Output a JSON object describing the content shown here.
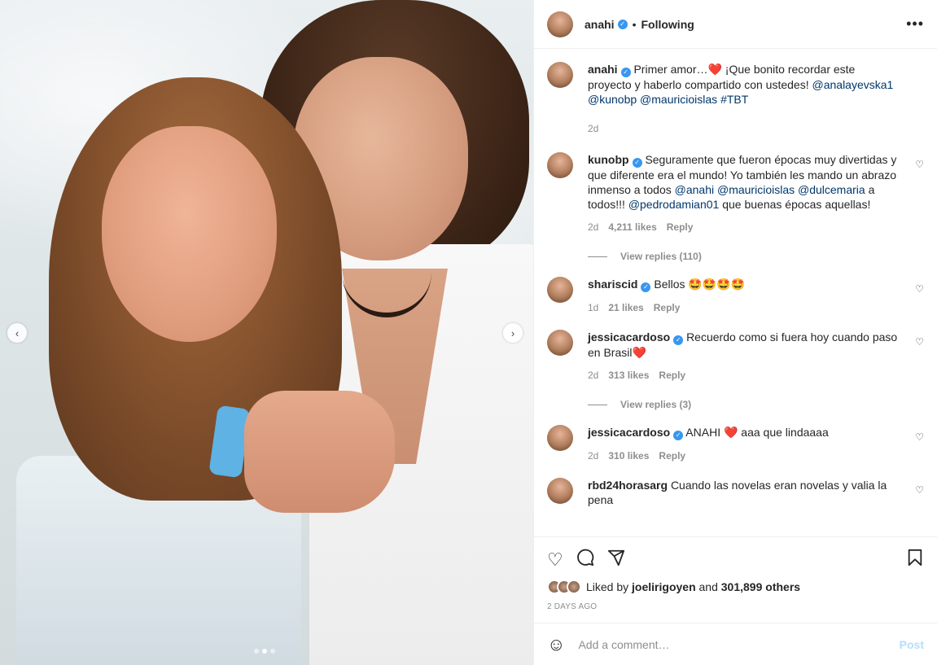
{
  "header": {
    "username": "anahi",
    "following_label": "Following",
    "more_icon": "more-icon"
  },
  "media": {
    "carousel_prev": "‹",
    "carousel_next": "›",
    "carousel_count": 3,
    "carousel_active_index": 1
  },
  "caption": {
    "username": "anahi",
    "text_start": "Primer amor…",
    "text_mid": " ¡Que bonito recordar este proyecto y haberlo compartido con ustedes! ",
    "mentions": [
      "@analayevska1",
      "@kunobp",
      "@mauricioislas"
    ],
    "hashtag": "#TBT",
    "time": "2d"
  },
  "comments": [
    {
      "username": "kunobp",
      "text_a": "Seguramente que fueron épocas muy divertidas y que diferente era el mundo! Yo también les mando un abrazo inmenso a todos ",
      "mention1": "@anahi",
      "mention2": "@mauricioislas",
      "mention3": "@dulcemaria",
      "text_b": " a todos!!! ",
      "mention4": "@pedrodamian01",
      "text_c": " que buenas épocas aquellas!",
      "time": "2d",
      "likes": "4,211 likes",
      "reply": "Reply",
      "view_replies": "View replies (110)"
    },
    {
      "username": "shariscid",
      "text": "Bellos 🤩🤩🤩🤩",
      "time": "1d",
      "likes": "21 likes",
      "reply": "Reply"
    },
    {
      "username": "jessicacardoso",
      "text": "Recuerdo como si fuera hoy cuando paso en Brasil",
      "time": "2d",
      "likes": "313 likes",
      "reply": "Reply",
      "view_replies": "View replies (3)"
    },
    {
      "username": "jessicacardoso",
      "text_a": "ANAHI ",
      "text_b": " aaa que lindaaaa",
      "time": "2d",
      "likes": "310 likes",
      "reply": "Reply"
    },
    {
      "username": "rbd24horasarg",
      "text": "Cuando las novelas eran novelas y valia la pena"
    }
  ],
  "actions": {
    "liked_by_prefix": "Liked by ",
    "liked_by_user": "joelirigoyen",
    "liked_by_and": " and ",
    "liked_by_count": "301,899 others",
    "timestamp": "2 DAYS AGO"
  },
  "add_comment": {
    "placeholder": "Add a comment…",
    "post_label": "Post"
  },
  "colors": {
    "verified": "#3897f0",
    "mention": "#00376b",
    "heart": "#ed1c3b",
    "post_disabled": "#b2dffc"
  }
}
